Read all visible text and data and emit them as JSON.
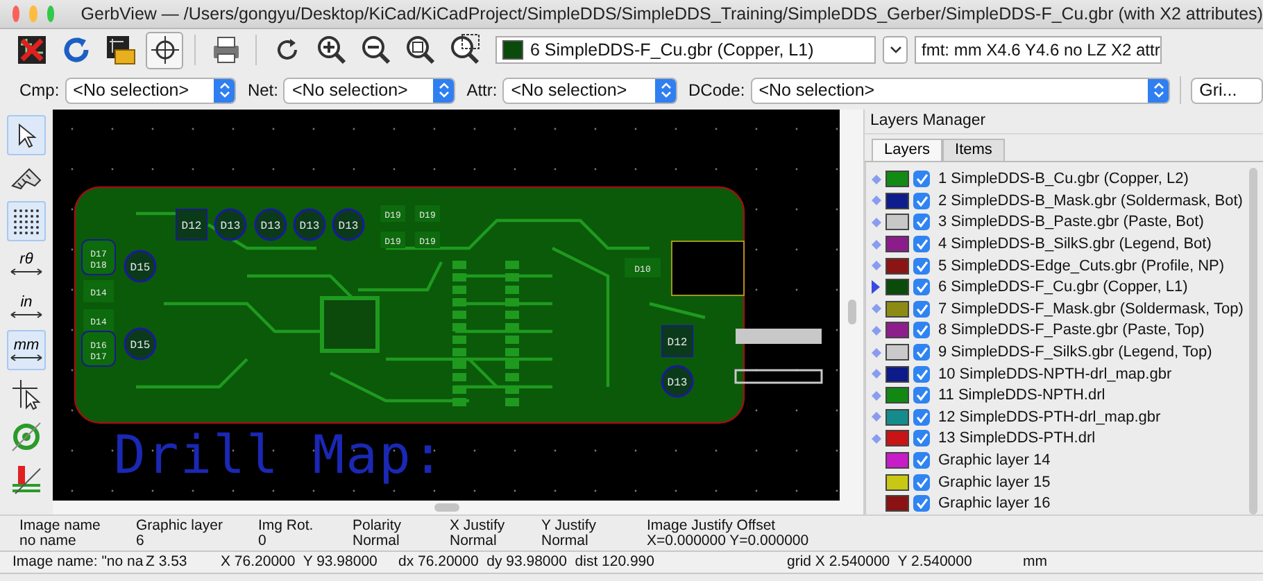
{
  "window": {
    "title": "GerbView — /Users/gongyu/Desktop/KiCad/KiCadProject/SimpleDDS/SimpleDDS_Training/SimpleDDS_Gerber/SimpleDDS-F_Cu.gbr (with X2 attributes)"
  },
  "toolbar": {
    "tools": [
      {
        "kind": "clear",
        "active": false
      },
      {
        "kind": "reload",
        "active": false
      },
      {
        "kind": "load",
        "active": false
      },
      {
        "kind": "crosshair",
        "active": true
      },
      {
        "kind": "print",
        "active": false
      },
      {
        "kind": "redraw",
        "active": false
      },
      {
        "kind": "zoom-in",
        "active": false
      },
      {
        "kind": "zoom-out",
        "active": false
      },
      {
        "kind": "zoom-fit",
        "active": false
      },
      {
        "kind": "zoom-area",
        "active": false
      }
    ],
    "layer_select": "6 SimpleDDS-F_Cu.gbr (Copper, L1)",
    "format": "fmt: mm X4.6 Y4.6 no LZ X2 attr"
  },
  "filters": [
    {
      "label": "Cmp:",
      "value": "<No selection>"
    },
    {
      "label": "Net:",
      "value": "<No selection>"
    },
    {
      "label": "Attr:",
      "value": "<No selection>"
    },
    {
      "label": "DCode:",
      "value": "<No selection>"
    }
  ],
  "display_select": "Gri...",
  "left_tools": [
    {
      "kind": "pointer",
      "active": true
    },
    {
      "kind": "measure",
      "active": false
    },
    {
      "kind": "grid",
      "active": true
    },
    {
      "kind": "polar",
      "active": false,
      "label": "rθ"
    },
    {
      "kind": "inch",
      "active": false,
      "label": "in"
    },
    {
      "kind": "mm",
      "active": true,
      "label": "mm"
    },
    {
      "kind": "cursor",
      "active": false
    },
    {
      "kind": "flash",
      "active": false
    },
    {
      "kind": "layers",
      "active": false
    }
  ],
  "canvas": {
    "pad_labels": [
      "D12",
      "D13",
      "D13",
      "D13",
      "D13",
      "D19",
      "D19",
      "D19",
      "D19",
      "D17",
      "D18",
      "D15",
      "D14",
      "D14",
      "D16",
      "D17",
      "D15",
      "D10",
      "D12",
      "D13"
    ],
    "drill_map_title": "Drill Map:"
  },
  "layers_manager": {
    "title": "Layers Manager",
    "tabs": [
      {
        "label": "Layers",
        "selected": true
      },
      {
        "label": "Items",
        "selected": false
      }
    ],
    "layers": [
      {
        "name": "1 SimpleDDS-B_Cu.gbr (Copper, L2)",
        "color": "#138a13",
        "visible": true,
        "selected": false,
        "loaded": true
      },
      {
        "name": "2 SimpleDDS-B_Mask.gbr (Soldermask, Bot)",
        "color": "#0e1c8c",
        "visible": true,
        "selected": false,
        "loaded": true
      },
      {
        "name": "3 SimpleDDS-B_Paste.gbr (Paste, Bot)",
        "color": "#c8c8c8",
        "visible": true,
        "selected": false,
        "loaded": true
      },
      {
        "name": "4 SimpleDDS-B_SilkS.gbr (Legend, Bot)",
        "color": "#8c1c8c",
        "visible": true,
        "selected": false,
        "loaded": true
      },
      {
        "name": "5 SimpleDDS-Edge_Cuts.gbr (Profile, NP)",
        "color": "#8c1414",
        "visible": true,
        "selected": false,
        "loaded": true
      },
      {
        "name": "6 SimpleDDS-F_Cu.gbr (Copper, L1)",
        "color": "#0a4a0a",
        "visible": true,
        "selected": true,
        "loaded": true
      },
      {
        "name": "7 SimpleDDS-F_Mask.gbr (Soldermask, Top)",
        "color": "#8c8c14",
        "visible": true,
        "selected": false,
        "loaded": true
      },
      {
        "name": "8 SimpleDDS-F_Paste.gbr (Paste, Top)",
        "color": "#8e1e8e",
        "visible": true,
        "selected": false,
        "loaded": true
      },
      {
        "name": "9 SimpleDDS-F_SilkS.gbr (Legend, Top)",
        "color": "#cacaca",
        "visible": true,
        "selected": false,
        "loaded": true
      },
      {
        "name": "10 SimpleDDS-NPTH-drl_map.gbr",
        "color": "#0c1a8a",
        "visible": true,
        "selected": false,
        "loaded": true
      },
      {
        "name": "11 SimpleDDS-NPTH.drl",
        "color": "#118811",
        "visible": true,
        "selected": false,
        "loaded": true
      },
      {
        "name": "12 SimpleDDS-PTH-drl_map.gbr",
        "color": "#148c8c",
        "visible": true,
        "selected": false,
        "loaded": true
      },
      {
        "name": "13 SimpleDDS-PTH.drl",
        "color": "#c81414",
        "visible": true,
        "selected": false,
        "loaded": true
      },
      {
        "name": "Graphic layer 14",
        "color": "#c81cc8",
        "visible": true,
        "selected": false,
        "loaded": false
      },
      {
        "name": "Graphic layer 15",
        "color": "#c8c814",
        "visible": true,
        "selected": false,
        "loaded": false
      },
      {
        "name": "Graphic layer 16",
        "color": "#8a1212",
        "visible": true,
        "selected": false,
        "loaded": false
      }
    ]
  },
  "info": [
    {
      "label": "Image name",
      "value": "no name"
    },
    {
      "label": "Graphic layer",
      "value": "6"
    },
    {
      "label": "Img Rot.",
      "value": "0"
    },
    {
      "label": "Polarity",
      "value": "Normal"
    },
    {
      "label": "X Justify",
      "value": "Normal"
    },
    {
      "label": "Y Justify",
      "value": "Normal"
    },
    {
      "label": "Image Justify Offset",
      "value": "X=0.000000 Y=0.000000"
    }
  ],
  "status_bar": [
    "Image name: \"no na",
    "Z 3.53",
    "X 76.20000  Y 93.98000",
    "dx 76.20000  dy 93.98000  dist 120.990",
    "grid X 2.540000  Y 2.540000",
    "mm"
  ]
}
